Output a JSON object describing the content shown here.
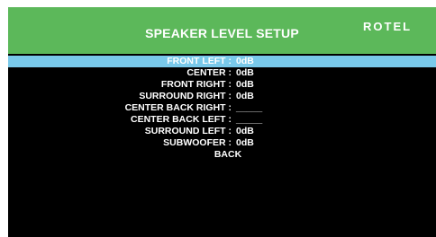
{
  "header": {
    "title": "SPEAKER LEVEL SETUP",
    "brand": "ROTEL",
    "background_color": "#5cb85a"
  },
  "menu": {
    "highlight_color": "#79c9ea",
    "selected_index": 0,
    "items": [
      {
        "label": "FRONT LEFT :",
        "value": "0dB"
      },
      {
        "label": "CENTER :",
        "value": "0dB"
      },
      {
        "label": "FRONT RIGHT :",
        "value": "0dB"
      },
      {
        "label": "SURROUND RIGHT :",
        "value": "0dB"
      },
      {
        "label": "CENTER BACK RIGHT :",
        "value": "_____"
      },
      {
        "label": "CENTER BACK LEFT :",
        "value": "_____"
      },
      {
        "label": "SURROUND LEFT :",
        "value": "0dB"
      },
      {
        "label": "SUBWOOFER :",
        "value": "0dB"
      }
    ],
    "back_label": "BACK"
  }
}
